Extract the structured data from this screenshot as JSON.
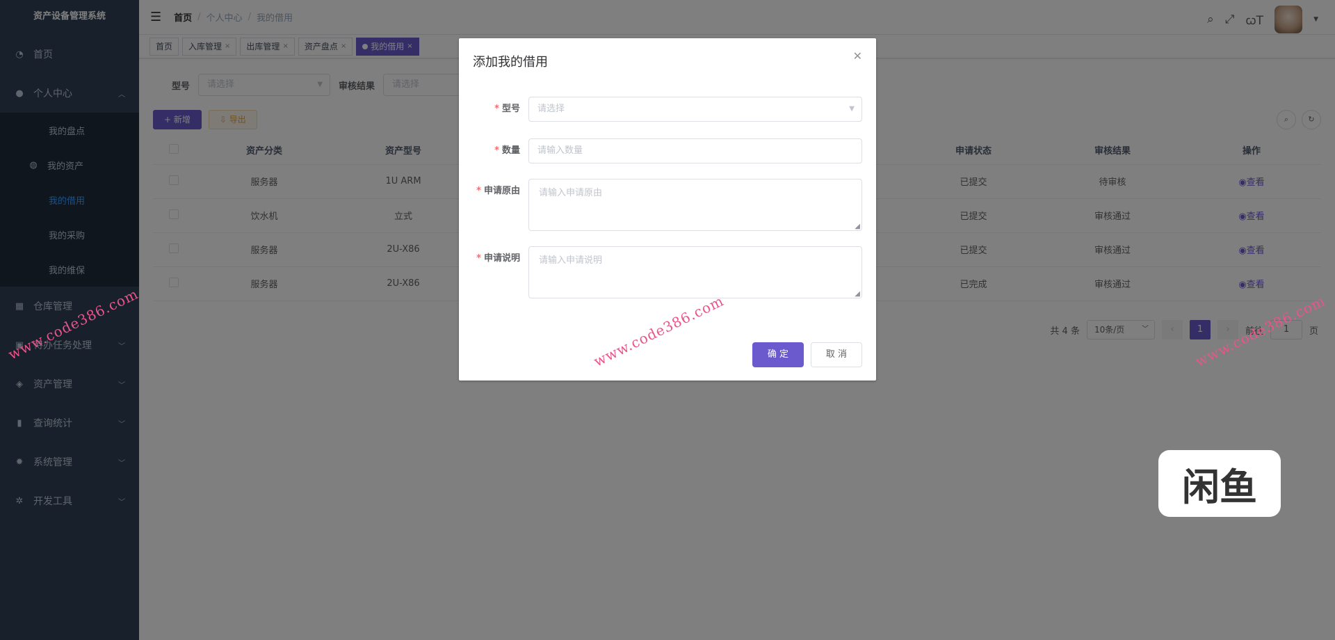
{
  "sidebar": {
    "title": "资产设备管理系统",
    "home": "首页",
    "personal": "个人中心",
    "sub": [
      "我的盘点",
      "我的资产",
      "我的借用",
      "我的采购",
      "我的维保"
    ],
    "warehouse": "仓库管理",
    "todo": "待办任务处理",
    "asset": "资产管理",
    "stats": "查询统计",
    "system": "系统管理",
    "dev": "开发工具"
  },
  "navbar": {
    "breadcrumb": [
      "首页",
      "个人中心",
      "我的借用"
    ]
  },
  "tags": [
    "首页",
    "入库管理",
    "出库管理",
    "资产盘点",
    "我的借用"
  ],
  "search": {
    "model_label": "型号",
    "model_placeholder": "请选择",
    "result_label": "审核结果",
    "result_placeholder": "请选择"
  },
  "toolbar": {
    "add": "+ 新增",
    "export": "导出"
  },
  "table": {
    "headers": [
      "资产分类",
      "资产型号",
      "申请状态",
      "审核结果",
      "操作"
    ],
    "rows": [
      {
        "category": "服务器",
        "model": "1U ARM",
        "status": "已提交",
        "result": "待审核",
        "action": "查看"
      },
      {
        "category": "饮水机",
        "model": "立式",
        "status": "已提交",
        "result": "审核通过",
        "action": "查看"
      },
      {
        "category": "服务器",
        "model": "2U-X86",
        "status": "已提交",
        "result": "审核通过",
        "action": "查看"
      },
      {
        "category": "服务器",
        "model": "2U-X86",
        "status": "已完成",
        "result": "审核通过",
        "action": "查看"
      }
    ]
  },
  "pager": {
    "total": "共 4 条",
    "size": "10条/页",
    "page": "1",
    "goto": "前往",
    "goto_value": "1",
    "unit": "页"
  },
  "dialog": {
    "title": "添加我的借用",
    "fields": [
      {
        "label": "型号",
        "placeholder": "请选择"
      },
      {
        "label": "数量",
        "placeholder": "请输入数量"
      },
      {
        "label": "申请原由",
        "placeholder": "请输入申请原由"
      },
      {
        "label": "申请说明",
        "placeholder": "请输入申请说明"
      }
    ],
    "ok": "确 定",
    "cancel": "取 消"
  },
  "watermark": {
    "url": "www.code386.com",
    "logo": "闲鱼"
  }
}
